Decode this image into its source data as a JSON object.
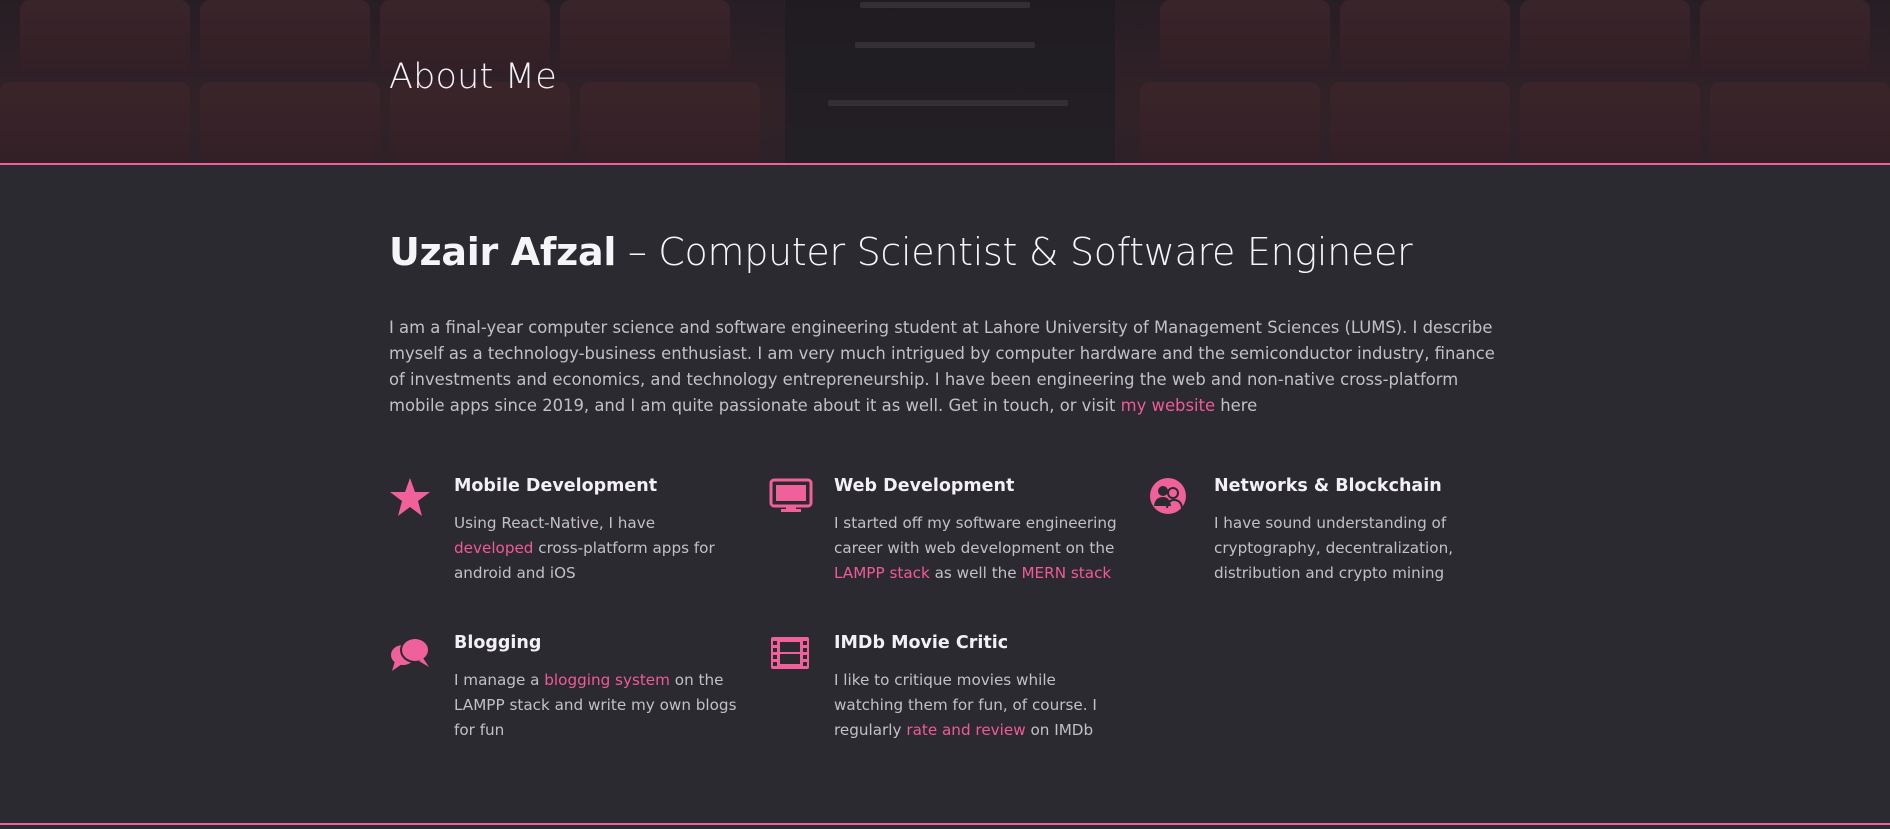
{
  "hero": {
    "title": "About Me"
  },
  "headline": {
    "name": "Uzair Afzal",
    "role": " – Computer Scientist & Software Engineer"
  },
  "intro": {
    "text": "I am a final-year computer science and software engineering student at Lahore University of Management Sciences (LUMS). I describe myself as a technology-business enthusiast. I am very much intrigued by computer hardware and the semiconductor industry, finance of investments and economics, and technology entrepreneurship. I have been engineering the web and non-native cross-platform mobile apps since 2019, and I am quite passionate about it as well. Get in touch, or visit ",
    "link_label": "my website",
    "after": " here"
  },
  "features": [
    {
      "icon": "star-icon",
      "title": "Mobile Development",
      "parts": [
        "Using React-Native, I have ",
        "developed",
        " cross-platform apps for android and iOS"
      ]
    },
    {
      "icon": "monitor-icon",
      "title": "Web Development",
      "parts": [
        "I started off my software engineering career with web development on the ",
        "LAMPP stack",
        " as well the ",
        "MERN stack",
        ""
      ]
    },
    {
      "icon": "users-circle-icon",
      "title": "Networks & Blockchain",
      "parts": [
        "I have sound understanding of cryptography, decentralization, distribution and crypto mining"
      ]
    },
    {
      "icon": "chat-bubbles-icon",
      "title": "Blogging",
      "parts": [
        "I manage a ",
        "blogging system",
        " on the LAMPP stack and write my own blogs for fun"
      ]
    },
    {
      "icon": "film-icon",
      "title": "IMDb Movie Critic",
      "parts": [
        "I like to critique movies while watching them for fun, of course. I regularly ",
        "rate and review",
        " on IMDb"
      ]
    }
  ],
  "colors": {
    "accent": "#f0609b",
    "background": "#2b2a30",
    "heading": "#f5f4f6",
    "body_text": "#c2c0c6"
  }
}
